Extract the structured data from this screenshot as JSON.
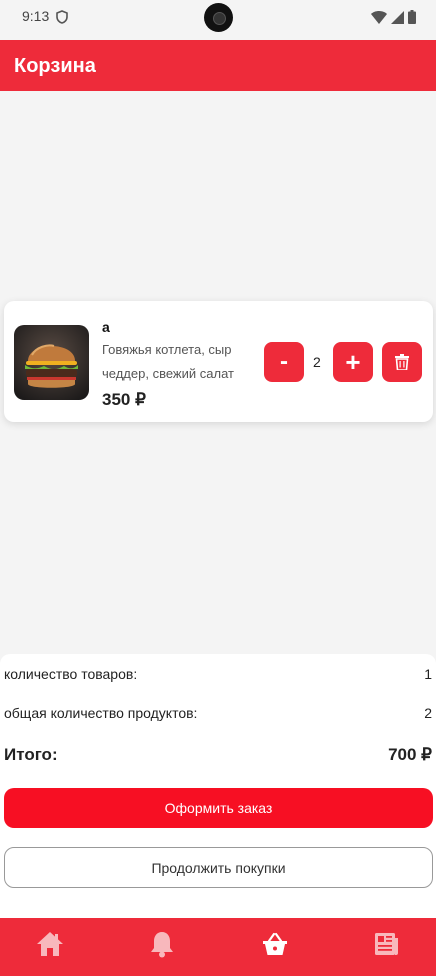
{
  "status_bar": {
    "time": "9:13"
  },
  "app_bar": {
    "title": "Корзина"
  },
  "cart_item": {
    "name": "а",
    "description": "Говяжья котлета, сыр чеддер, свежий салат",
    "price": "350 ₽",
    "quantity": "2",
    "minus_label": "-",
    "plus_label": "+"
  },
  "summary": {
    "items_count_label": "количество товаров:",
    "items_count_value": "1",
    "products_total_label": "общая количество продуктов:",
    "products_total_value": "2",
    "total_label": "Итого:",
    "total_value": "700 ₽"
  },
  "actions": {
    "order_label": "Оформить заказ",
    "continue_label": "Продолжить покупки"
  },
  "bottom_nav": {
    "items": [
      {
        "icon": "home-icon"
      },
      {
        "icon": "bell-icon"
      },
      {
        "icon": "basket-icon"
      },
      {
        "icon": "newspaper-icon"
      }
    ]
  },
  "colors": {
    "accent": "#ee2b3a",
    "order_button": "#f70f23"
  }
}
